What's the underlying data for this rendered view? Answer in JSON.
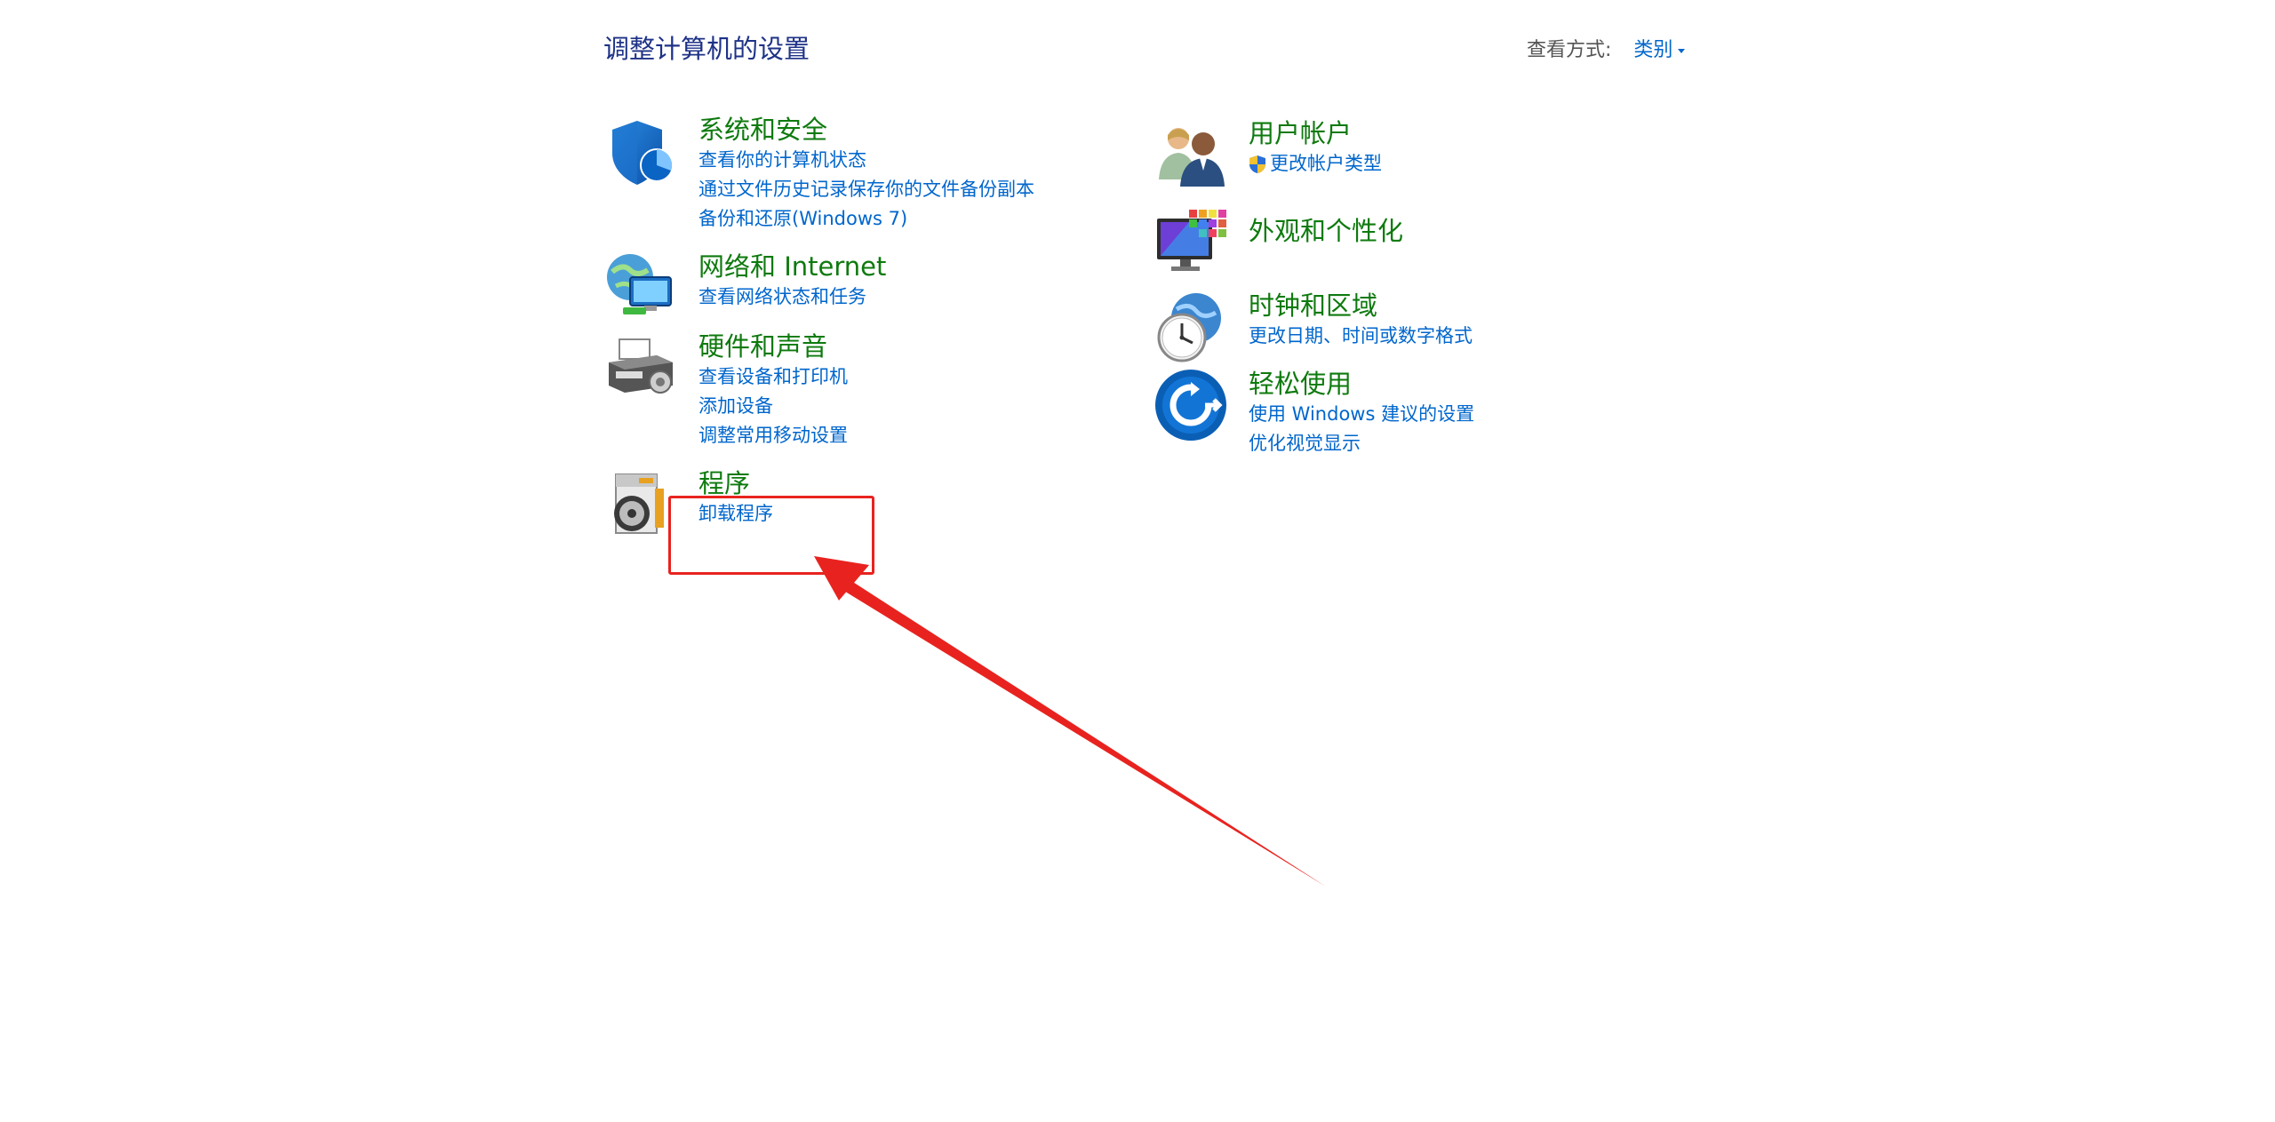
{
  "header": {
    "title": "调整计算机的设置",
    "view_by_label": "查看方式:",
    "view_by_value": "类别"
  },
  "categories": {
    "system_security": {
      "title": "系统和安全",
      "links": [
        "查看你的计算机状态",
        "通过文件历史记录保存你的文件备份副本",
        "备份和还原(Windows 7)"
      ]
    },
    "network": {
      "title": "网络和 Internet",
      "links": [
        "查看网络状态和任务"
      ]
    },
    "hardware": {
      "title": "硬件和声音",
      "links": [
        "查看设备和打印机",
        "添加设备",
        "调整常用移动设置"
      ]
    },
    "programs": {
      "title": "程序",
      "links": [
        "卸载程序"
      ]
    },
    "user_accounts": {
      "title": "用户帐户",
      "links": [
        "更改帐户类型"
      ]
    },
    "appearance": {
      "title": "外观和个性化",
      "links": []
    },
    "clock_region": {
      "title": "时钟和区域",
      "links": [
        "更改日期、时间或数字格式"
      ]
    },
    "ease_of_access": {
      "title": "轻松使用",
      "links": [
        "使用 Windows 建议的设置",
        "优化视觉显示"
      ]
    }
  },
  "colors": {
    "category_title": "#0e7a0e",
    "link": "#0066cc",
    "header": "#1e3287",
    "annotation": "#e8231f"
  }
}
